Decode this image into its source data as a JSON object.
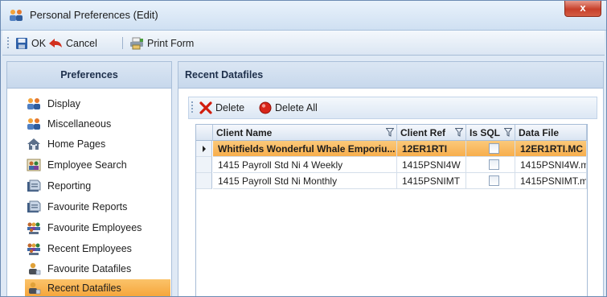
{
  "window": {
    "title": "Personal Preferences (Edit)",
    "close_glyph": "x"
  },
  "toolbar": {
    "ok_label": "OK",
    "cancel_label": "Cancel",
    "print_label": "Print Form"
  },
  "left_panel": {
    "header": "Preferences",
    "items": [
      {
        "label": "Display",
        "icon": "people-icon"
      },
      {
        "label": "Miscellaneous",
        "icon": "people-icon"
      },
      {
        "label": "Home Pages",
        "icon": "home-icon"
      },
      {
        "label": "Employee Search",
        "icon": "employee-search-icon"
      },
      {
        "label": "Reporting",
        "icon": "report-icon"
      },
      {
        "label": "Favourite Reports",
        "icon": "report-icon"
      },
      {
        "label": "Favourite Employees",
        "icon": "group-icon"
      },
      {
        "label": "Recent Employees",
        "icon": "group-icon"
      },
      {
        "label": "Favourite Datafiles",
        "icon": "person-icon"
      },
      {
        "label": "Recent Datafiles",
        "icon": "person-icon",
        "selected": true
      }
    ]
  },
  "right_panel": {
    "header": "Recent Datafiles",
    "delete_label": "Delete",
    "delete_all_label": "Delete All",
    "columns": [
      "Client Name",
      "Client Ref",
      "Is SQL",
      "Data File"
    ],
    "rows": [
      {
        "client_name": "Whitfields Wonderful Whale Emporiu...",
        "client_ref": "12ER1RTI",
        "is_sql": false,
        "data_file": "12ER1RTI.MC",
        "selected": true
      },
      {
        "client_name": "1415 Payroll Std Ni 4 Weekly",
        "client_ref": "1415PSNI4W",
        "is_sql": false,
        "data_file": "1415PSNI4W.m",
        "selected": false
      },
      {
        "client_name": "1415 Payroll Std Ni Monthly",
        "client_ref": "1415PSNIMT",
        "is_sql": false,
        "data_file": "1415PSNIMT.m",
        "selected": false
      }
    ]
  },
  "colors": {
    "accent_selected": "#f7ae4c",
    "delete_x": "#d11d0d",
    "delete_all_dot": "#d8251a"
  }
}
